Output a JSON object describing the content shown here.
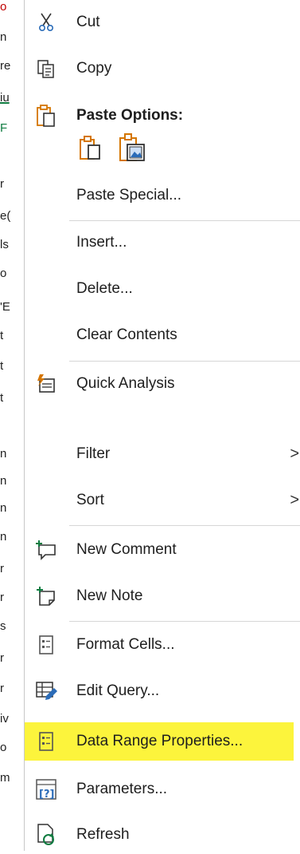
{
  "sheet_fragments": [
    "o",
    "n",
    "re",
    "iu",
    "F",
    "",
    "r",
    "e(",
    "ls",
    "o",
    "'E",
    "t",
    "t",
    "t",
    "n",
    "n",
    "n",
    "n",
    "r",
    "r",
    "s",
    "r",
    "r",
    "iv",
    "o",
    "m",
    ""
  ],
  "menu": {
    "cut": {
      "label": "Cut",
      "icon": "scissors-icon"
    },
    "copy": {
      "label": "Copy",
      "icon": "copy-icon"
    },
    "paste_options": {
      "label": "Paste Options:",
      "icon": "clipboard-icon"
    },
    "paste_special": {
      "label": "Paste Special..."
    },
    "insert": {
      "label": "Insert..."
    },
    "delete": {
      "label": "Delete..."
    },
    "clear_contents": {
      "label": "Clear Contents"
    },
    "quick_analysis": {
      "label": "Quick Analysis",
      "icon": "quick-analysis-icon"
    },
    "filter": {
      "label": "Filter",
      "arrow": ">"
    },
    "sort": {
      "label": "Sort",
      "arrow": ">"
    },
    "new_comment": {
      "label": "New Comment",
      "icon": "new-comment-icon"
    },
    "new_note": {
      "label": "New Note",
      "icon": "new-note-icon"
    },
    "format_cells": {
      "label": "Format Cells...",
      "icon": "format-cells-icon"
    },
    "edit_query": {
      "label": "Edit Query...",
      "icon": "edit-query-icon"
    },
    "data_range_properties": {
      "label": "Data Range Properties...",
      "icon": "data-range-properties-icon"
    },
    "parameters": {
      "label": "Parameters...",
      "icon": "parameters-icon"
    },
    "refresh": {
      "label": "Refresh",
      "icon": "refresh-icon"
    }
  },
  "colors": {
    "highlight": "#fcf43c",
    "accent_orange": "#d47500",
    "accent_green": "#107c41",
    "accent_blue": "#2b6cb8"
  }
}
